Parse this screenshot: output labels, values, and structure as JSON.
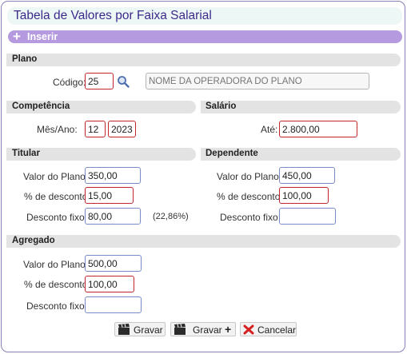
{
  "window": {
    "title": "Tabela de Valores por Faixa Salarial"
  },
  "toolbar": {
    "insert_label": "Inserir",
    "insert_icon": "plus-icon"
  },
  "plano": {
    "section": "Plano",
    "codigo_label": "Código:",
    "codigo_value": "25",
    "operadora_placeholder": "NOME DA OPERADORA DO PLANO"
  },
  "competencia": {
    "section": "Competência",
    "mes_ano_label": "Mês/Ano:",
    "mes_value": "12",
    "ano_value": "2023"
  },
  "salario": {
    "section": "Salário",
    "ate_label": "Até:",
    "ate_value": "2.800,00"
  },
  "titular": {
    "section": "Titular",
    "valor_label": "Valor do Plano:",
    "valor_value": "350,00",
    "pct_label": "% de desconto:",
    "pct_value": "15,00",
    "fixo_label": "Desconto fixo:",
    "fixo_value": "80,00",
    "fixo_pct_note": "(22,86%)"
  },
  "dependente": {
    "section": "Dependente",
    "valor_label": "Valor do Plano:",
    "valor_value": "450,00",
    "pct_label": "% de desconto:",
    "pct_value": "100,00",
    "fixo_label": "Desconto fixo:",
    "fixo_value": ""
  },
  "agregado": {
    "section": "Agregado",
    "valor_label": "Valor do Plano:",
    "valor_value": "500,00",
    "pct_label": "% de desconto:",
    "pct_value": "100,00",
    "fixo_label": "Desconto fixo:",
    "fixo_value": ""
  },
  "actions": {
    "save_label": "Gravar",
    "save_plus_label": "Gravar",
    "cancel_label": "Cancelar"
  },
  "colors": {
    "title_text": "#3c2a8a",
    "insert_bar": "#b59adf",
    "required_border": "#c0262a",
    "input_border": "#7a8cc8"
  }
}
